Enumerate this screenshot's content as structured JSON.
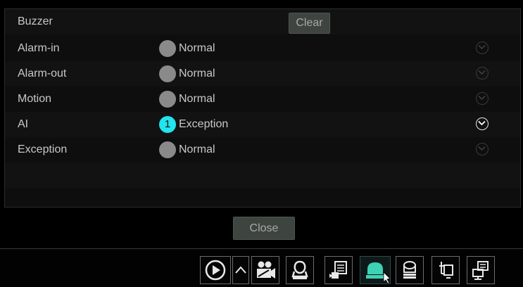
{
  "header": {
    "title": "Buzzer",
    "clear_label": "Clear"
  },
  "rows": [
    {
      "name": "Alarm-in",
      "status": "Normal",
      "badge": ""
    },
    {
      "name": "Alarm-out",
      "status": "Normal",
      "badge": ""
    },
    {
      "name": "Motion",
      "status": "Normal",
      "badge": ""
    },
    {
      "name": "AI",
      "status": "Exception",
      "badge": "1"
    },
    {
      "name": "Exception",
      "status": "Normal",
      "badge": ""
    }
  ],
  "footer": {
    "close_label": "Close"
  },
  "taskbar": {
    "icons": [
      "play-icon",
      "chevron-up-icon",
      "camera-icon",
      "account-icon",
      "playback-record-icon",
      "alarm-light-icon",
      "disk-icon",
      "network-icon",
      "monitor-icon"
    ]
  },
  "colors": {
    "active_badge": "#22e4ee",
    "inactive_badge": "#8a8a8a"
  }
}
